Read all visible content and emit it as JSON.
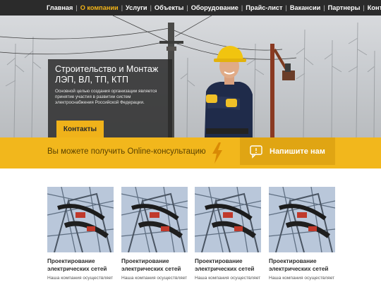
{
  "nav": {
    "items": [
      {
        "label": "Главная",
        "active": false
      },
      {
        "label": "О компании",
        "active": true
      },
      {
        "label": "Услуги",
        "active": false
      },
      {
        "label": "Объекты",
        "active": false
      },
      {
        "label": "Оборудование",
        "active": false
      },
      {
        "label": "Прайс-лист",
        "active": false
      },
      {
        "label": "Вакансии",
        "active": false
      },
      {
        "label": "Партнеры",
        "active": false
      },
      {
        "label": "Контакты",
        "active": false
      }
    ],
    "separator": "|"
  },
  "hero": {
    "title": "Строительство и Монтаж ЛЭП, ВЛ, ТП, КТП",
    "text": "Основной целью создания организации является принятие участия в развитии систем электроснабжения Российской Федерации.",
    "button_label": "Контакты"
  },
  "band": {
    "text": "Вы можете получить Online-консультацию",
    "cta_label": "Напишите нам"
  },
  "cards": [
    {
      "title": "Проектирование электрических сетей",
      "text": "Наша компания осуществляет"
    },
    {
      "title": "Проектирование электрических сетей",
      "text": "Наша компания осуществляет"
    },
    {
      "title": "Проектирование электрических сетей",
      "text": "Наша компания осуществляет"
    },
    {
      "title": "Проектирование электрических сетей",
      "text": "Наша компания осуществляет"
    }
  ],
  "colors": {
    "accent": "#f2b71c",
    "nav_bg": "#2b2b2b",
    "nav_active": "#f2b418"
  },
  "icons": {
    "band_icon": "lightning-bolt-icon",
    "cta_icon": "chat-bubble-icon"
  }
}
